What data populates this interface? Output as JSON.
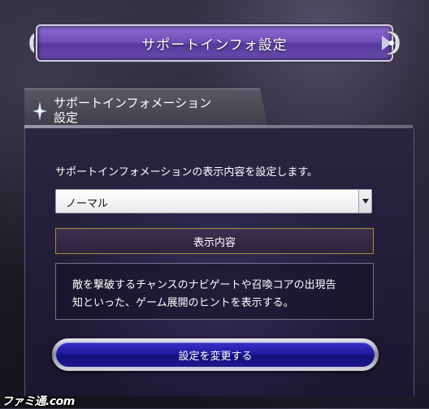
{
  "header": {
    "title": "サポートインフォ設定"
  },
  "panel": {
    "title_line1": "サポートインフォメーション",
    "title_line2": "設定",
    "description": "サポートインフォメーションの表示内容を設定します。",
    "select": {
      "value": "ノーマル"
    },
    "content_header": "表示内容",
    "content_text_line1": "敵を撃破するチャンスのナビゲートや召喚コアの出現告",
    "content_text_line2": "知といった、ゲーム展開のヒントを表示する。",
    "submit_label": "設定を変更する"
  },
  "watermark": {
    "text": "ファミ通.com"
  },
  "colors": {
    "header_purple": "#6f4fb8",
    "button_blue": "#1f1ba0",
    "content_header_border": "#a58e3c"
  },
  "icons": [
    "ornament-left-icon",
    "ornament-right-icon",
    "star-icon",
    "dropdown-arrow-icon"
  ]
}
